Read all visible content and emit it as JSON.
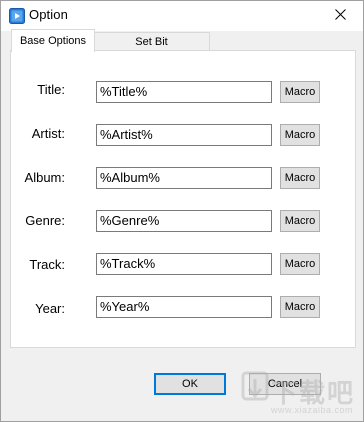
{
  "window": {
    "title": "Option",
    "close_icon": "close-icon",
    "app_icon": "media-player-icon"
  },
  "tabs": [
    {
      "label": "Base Options",
      "active": true
    },
    {
      "label": "Set Bit",
      "active": false
    }
  ],
  "fields": [
    {
      "label": "Title:",
      "value": "%Title%",
      "macro_label": "Macro"
    },
    {
      "label": "Artist:",
      "value": "%Artist%",
      "macro_label": "Macro"
    },
    {
      "label": "Album:",
      "value": "%Album%",
      "macro_label": "Macro"
    },
    {
      "label": "Genre:",
      "value": "%Genre%",
      "macro_label": "Macro"
    },
    {
      "label": "Track:",
      "value": "%Track%",
      "macro_label": "Macro"
    },
    {
      "label": "Year:",
      "value": "%Year%",
      "macro_label": "Macro"
    }
  ],
  "footer": {
    "ok_label": "OK",
    "cancel_label": "Cancel"
  },
  "watermark": {
    "brand": "下载吧",
    "url": "www.xiazaiba.com"
  },
  "colors": {
    "focus_border": "#0078d7",
    "button_bg": "#e1e1e1",
    "dialog_bg": "#f0f0f0"
  }
}
